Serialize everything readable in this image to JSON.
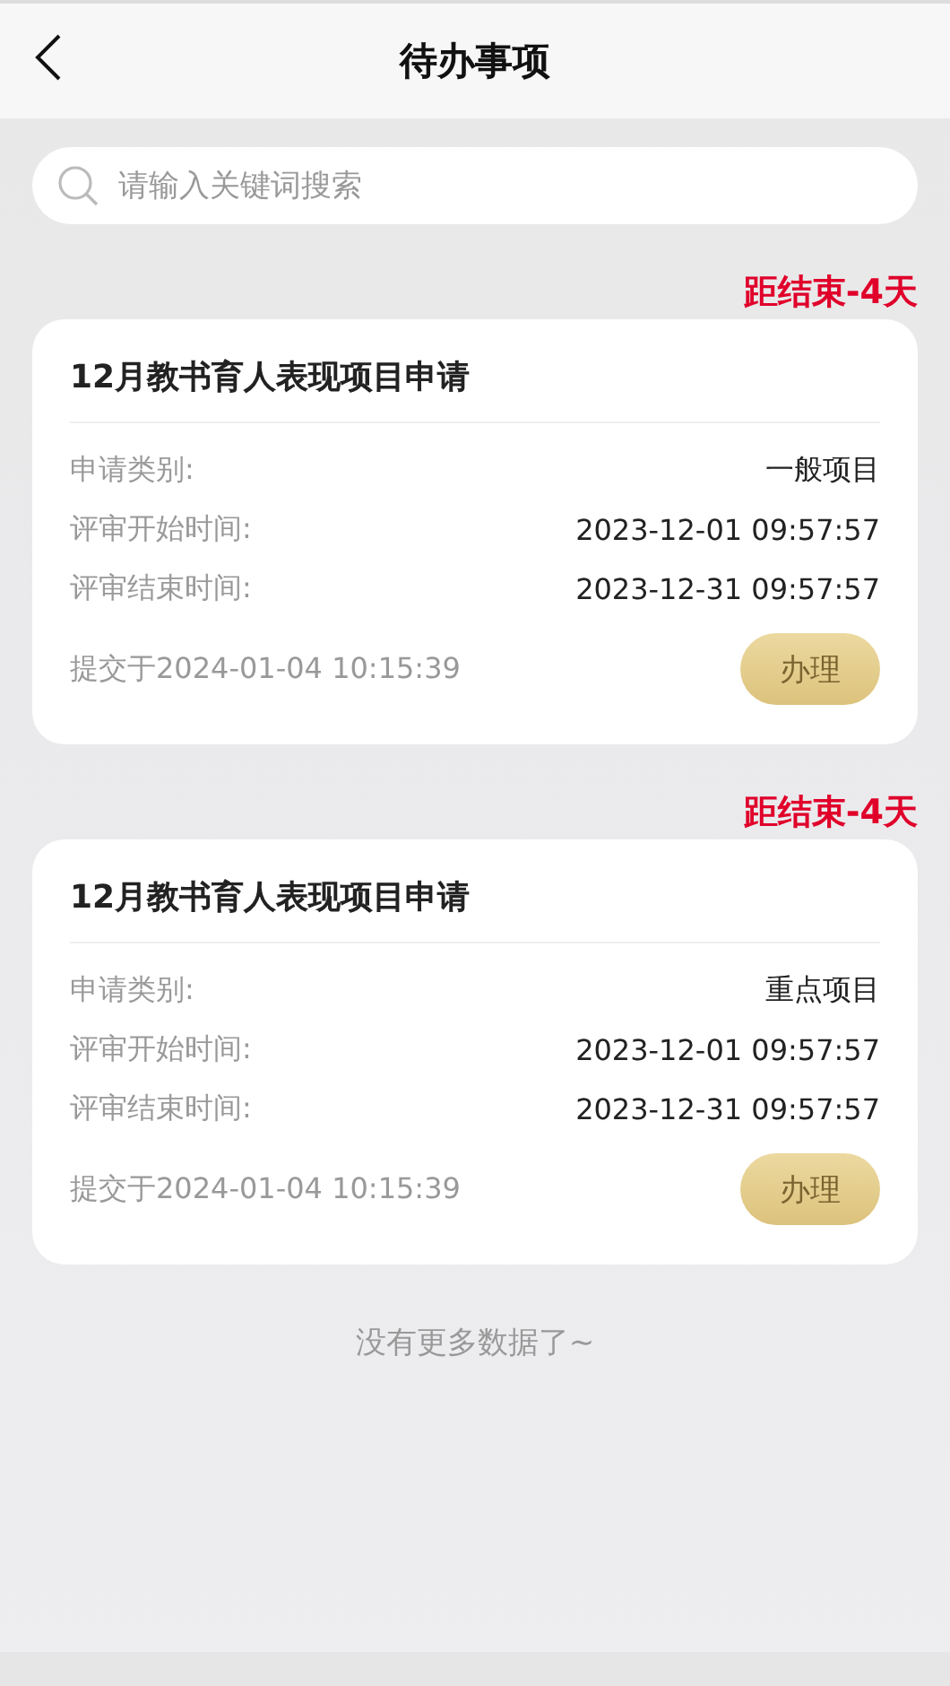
{
  "header": {
    "title": "待办事项"
  },
  "search": {
    "placeholder": "请输入关键词搜索"
  },
  "items": [
    {
      "deadline": "距结束-4天",
      "title": "12月教书育人表现项目申请",
      "fields": [
        {
          "label": "申请类别:",
          "value": "一般项目"
        },
        {
          "label": "评审开始时间:",
          "value": "2023-12-01 09:57:57"
        },
        {
          "label": "评审结束时间:",
          "value": "2023-12-31 09:57:57"
        }
      ],
      "submitted": "提交于2024-01-04 10:15:39",
      "action": "办理"
    },
    {
      "deadline": "距结束-4天",
      "title": "12月教书育人表现项目申请",
      "fields": [
        {
          "label": "申请类别:",
          "value": "重点项目"
        },
        {
          "label": "评审开始时间:",
          "value": "2023-12-01 09:57:57"
        },
        {
          "label": "评审结束时间:",
          "value": "2023-12-31 09:57:57"
        }
      ],
      "submitted": "提交于2024-01-04 10:15:39",
      "action": "办理"
    }
  ],
  "footer": "没有更多数据了~"
}
